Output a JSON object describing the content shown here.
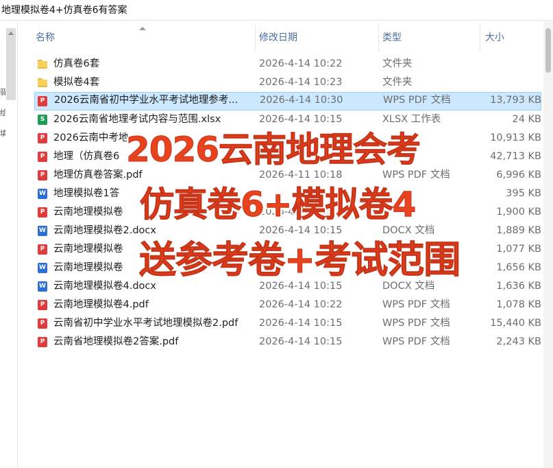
{
  "window": {
    "title": "地理模拟卷4+仿真卷6有答案"
  },
  "columns": {
    "name": "名称",
    "date": "修改日期",
    "type": "类型",
    "size": "大小"
  },
  "left_pane_glyphs": [
    "驿",
    "绘",
    "填"
  ],
  "files": [
    {
      "icon": "folder-icon",
      "kind": "folder",
      "name": "仿真卷6套",
      "date": "2026-4-14 10:22",
      "type": "文件夹",
      "size": ""
    },
    {
      "icon": "folder-icon",
      "kind": "folder",
      "name": "模拟卷4套",
      "date": "2026-4-14 10:23",
      "type": "文件夹",
      "size": ""
    },
    {
      "icon": "pdf-file-icon",
      "kind": "pdf",
      "name": "2026云南省初中学业水平考试地理参考...",
      "date": "2026-4-14 10:30",
      "type": "WPS PDF 文档",
      "size": "13,793 KB",
      "selected": true
    },
    {
      "icon": "excel-file-icon",
      "kind": "xlsx",
      "name": "2026云南省地理考试内容与范围.xlsx",
      "date": "2026-4-14 10:15",
      "type": "XLSX 工作表",
      "size": "24 KB"
    },
    {
      "icon": "pdf-file-icon",
      "kind": "pdf",
      "name": "2026云南中考地",
      "date": "",
      "type": "",
      "size": "10,913 KB"
    },
    {
      "icon": "pdf-file-icon",
      "kind": "pdf",
      "name": "地理（仿真卷6",
      "date": "",
      "type": "",
      "size": "42,713 KB"
    },
    {
      "icon": "pdf-file-icon",
      "kind": "pdf",
      "name": "地理仿真卷答案.pdf",
      "date": "2026-4-11 10:18",
      "type": "WPS PDF 文档",
      "size": "6,996 KB"
    },
    {
      "icon": "word-file-icon",
      "kind": "docx",
      "name": "地理模拟卷1答",
      "date": "",
      "type": "",
      "size": "395 KB"
    },
    {
      "icon": "pdf-file-icon",
      "kind": "pdf",
      "name": "云南地理模拟卷",
      "date": "2026-4-14 10:15",
      "type": "",
      "size": "1,900 KB"
    },
    {
      "icon": "word-file-icon",
      "kind": "docx",
      "name": "云南地理模拟卷2.docx",
      "date": "2026-4-14 10:15",
      "type": "DOCX 文档",
      "size": "1,889 KB"
    },
    {
      "icon": "pdf-file-icon",
      "kind": "pdf",
      "name": "云南地理模拟卷",
      "date": "",
      "type": "",
      "size": "1,077 KB"
    },
    {
      "icon": "word-file-icon",
      "kind": "docx",
      "name": "云南地理模拟卷",
      "date": "",
      "type": "",
      "size": "1,656 KB"
    },
    {
      "icon": "word-file-icon",
      "kind": "docx",
      "name": "云南地理模拟卷4.docx",
      "date": "2026-4-14 10:15",
      "type": "DOCX 文档",
      "size": "1,636 KB"
    },
    {
      "icon": "pdf-file-icon",
      "kind": "pdf",
      "name": "云南地理模拟卷4.pdf",
      "date": "2026-4-14 10:22",
      "type": "WPS PDF 文档",
      "size": "1,078 KB"
    },
    {
      "icon": "pdf-file-icon",
      "kind": "pdf",
      "name": "云南省初中学业水平考试地理模拟卷2.pdf",
      "date": "2026-4-14 10:15",
      "type": "WPS PDF 文档",
      "size": "15,440 KB"
    },
    {
      "icon": "pdf-file-icon",
      "kind": "pdf",
      "name": "云南省地理模拟卷2答案.pdf",
      "date": "2026-4-14 10:15",
      "type": "WPS PDF 文档",
      "size": "2,243 KB"
    }
  ],
  "promo": {
    "line1": "2026云南地理会考",
    "line2": "仿真卷6+模拟卷4",
    "line3": "送参考卷+考试范围"
  },
  "colors": {
    "selection_bg": "#cce8ff",
    "selection_border": "#99d1ff",
    "promo_text": "#e8431f",
    "header_text": "#4d6fa0"
  }
}
